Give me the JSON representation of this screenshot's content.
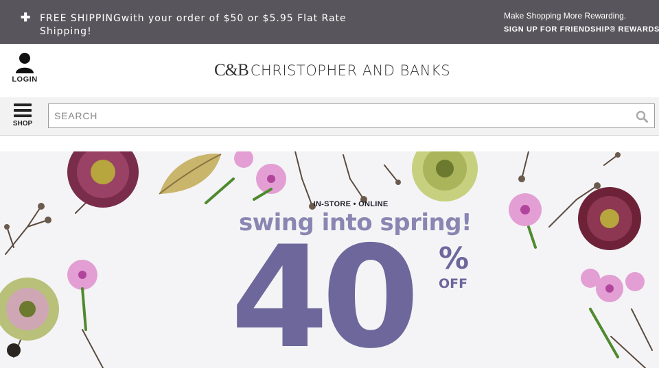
{
  "promo": {
    "plus_icon": "plus-icon",
    "shipping_text": "FREE SHIPPINGwith your order of $50 or $5.95 Flat Rate Shipping!",
    "rewards_line1": "Make Shopping More Rewarding.",
    "rewards_line2": "SIGN UP FOR FRIENDSHIP® REWARDS"
  },
  "header": {
    "login_icon": "user-icon",
    "login_label": "LOGIN",
    "logo_mark": "C&B",
    "logo_text": "CHRISTOPHER AND BANKS"
  },
  "nav": {
    "shop_icon": "hamburger-menu-icon",
    "shop_label": "SHOP",
    "search_placeholder": "SEARCH",
    "search_value": "",
    "search_icon": "search-icon"
  },
  "hero": {
    "kicker": "IN-STORE • ONLINE",
    "tagline": "swing into spring!",
    "discount_number": "40",
    "discount_symbol": "%",
    "discount_off": "OFF"
  },
  "colors": {
    "promo_bg": "#58565c",
    "accent_purple": "#6d679c",
    "tagline_lavender": "#8a86b2"
  }
}
